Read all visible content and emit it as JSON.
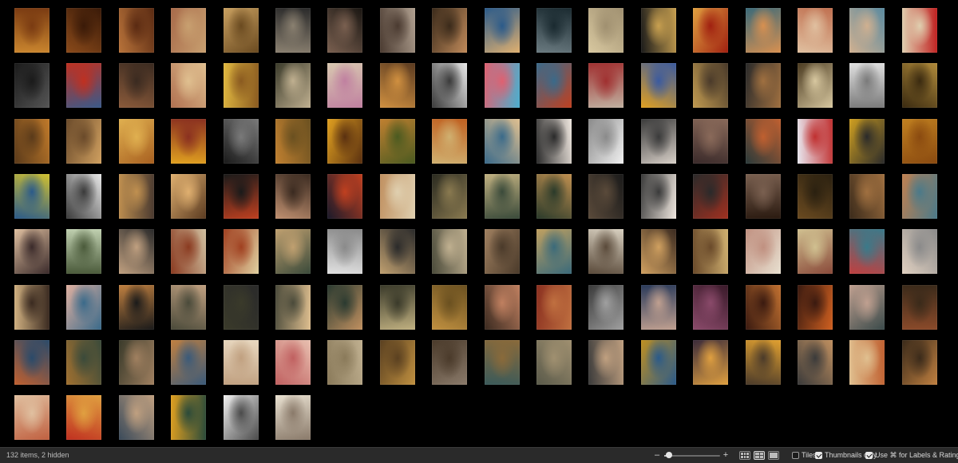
{
  "status": {
    "item_count": "132 items, 2 hidden",
    "zoom": {
      "minus": "–",
      "plus": "+",
      "level": 0.09
    },
    "options": [
      {
        "label": "Tiles",
        "checked": false
      },
      {
        "label": "Thumbnails only",
        "checked": true
      },
      {
        "label": "Use ⌘ for Labels & Ratings",
        "checked": true
      }
    ]
  },
  "thumbnails": {
    "visible_count": 132,
    "columns": 18,
    "palette": [
      [
        "#c9852e",
        "#7a3b12"
      ],
      [
        "#8a4a1a",
        "#3a1a08"
      ],
      [
        "#b8733a",
        "#5a2a12"
      ],
      [
        "#a86a4a",
        "#c8a070"
      ],
      [
        "#c9a060",
        "#6a4a20"
      ],
      [
        "#2a2a2a",
        "#8a8070"
      ],
      [
        "#1a1612",
        "#7a6050"
      ],
      [
        "#b0a090",
        "#4a3a30"
      ],
      [
        "#c08a5a",
        "#3a2a1a"
      ],
      [
        "#e0b070",
        "#2a5a8a"
      ],
      [
        "#6a7a80",
        "#1a2a30"
      ],
      [
        "#d8c8a0",
        "#a09070"
      ],
      [
        "#1a1a1a",
        "#c8a050"
      ],
      [
        "#e0a040",
        "#a02010"
      ],
      [
        "#3a6a7a",
        "#d89050"
      ],
      [
        "#c07050",
        "#e0c0a0"
      ],
      [
        "#5a8aa0",
        "#d0b090"
      ],
      [
        "#c02020",
        "#e0d0b0"
      ],
      [
        "#555555",
        "#1a1a1a"
      ],
      [
        "#3a5a8a",
        "#c03020"
      ],
      [
        "#8a5a3a",
        "#3a2a20"
      ],
      [
        "#b07050",
        "#e0c090"
      ],
      [
        "#e0b840",
        "#8a5a20"
      ],
      [
        "#3a3a2a",
        "#c0b090"
      ],
      [
        "#d8c8b0",
        "#c080a0"
      ],
      [
        "#5a3a20",
        "#d09040"
      ],
      [
        "#e8e8e8",
        "#3a3a3a"
      ],
      [
        "#4ab0d0",
        "#e06070"
      ],
      [
        "#c04020",
        "#3a6a8a"
      ],
      [
        "#c0b0a0",
        "#a03030"
      ],
      [
        "#e0a020",
        "#3a5aa0"
      ],
      [
        "#c09a50",
        "#4a3a2a"
      ],
      [
        "#2a2a2a",
        "#a07040"
      ],
      [
        "#4a3a20",
        "#d8c8a0"
      ],
      [
        "#e0e0e0",
        "#7a7a7a"
      ],
      [
        "#b08a3a",
        "#3a2a10"
      ],
      [
        "#c07a2a",
        "#5a3a1a"
      ],
      [
        "#d0a060",
        "#6a4a2a"
      ],
      [
        "#a86020",
        "#e0b050"
      ],
      [
        "#e0a020",
        "#8a3020"
      ],
      [
        "#1a1a1a",
        "#7a7a7a"
      ],
      [
        "#c08030",
        "#6a5020"
      ],
      [
        "#e0a020",
        "#5a3010"
      ],
      [
        "#c08030",
        "#4a5a20"
      ],
      [
        "#c06020",
        "#d0b070"
      ],
      [
        "#e0c090",
        "#3a6a8a"
      ],
      [
        "#f0e8e0",
        "#2a2a2a"
      ],
      [
        "#f0f0f0",
        "#8a8a8a"
      ],
      [
        "#d8d0c8",
        "#3a3a3a"
      ],
      [
        "#3a2a2a",
        "#8a6a5a"
      ],
      [
        "#2a3a3a",
        "#c06030"
      ],
      [
        "#e8e8f0",
        "#c03030"
      ],
      [
        "#d0a020",
        "#2a2a2a"
      ],
      [
        "#c08020",
        "#8a4a10"
      ],
      [
        "#d0c030",
        "#2a5a8a"
      ],
      [
        "#e8e8e8",
        "#3a3a3a"
      ],
      [
        "#4a3a30",
        "#c09050"
      ],
      [
        "#5a3a20",
        "#e0b070"
      ],
      [
        "#c04020",
        "#1a1a1a"
      ],
      [
        "#c09070",
        "#3a2a20"
      ],
      [
        "#1a1a2a",
        "#c04020"
      ],
      [
        "#c09060",
        "#e0d0b0"
      ],
      [
        "#2a2a20",
        "#8a7a50"
      ],
      [
        "#c0b080",
        "#3a4a3a"
      ],
      [
        "#c09050",
        "#2a3a2a"
      ],
      [
        "#1a1a1a",
        "#5a4a3a"
      ],
      [
        "#f0e8e0",
        "#3a3a3a"
      ],
      [
        "#a03020",
        "#2a2a2a"
      ],
      [
        "#2a1a10",
        "#7a6050"
      ],
      [
        "#6a4a20",
        "#2a2010"
      ],
      [
        "#3a2a1a",
        "#a07040"
      ],
      [
        "#c08050",
        "#4a7a8a"
      ],
      [
        "#e0c0a0",
        "#3a2a2a"
      ],
      [
        "#c0d0b0",
        "#4a5a3a"
      ],
      [
        "#2a2a2a",
        "#c0a080"
      ],
      [
        "#d0c0a0",
        "#8a3a20"
      ],
      [
        "#e0d0a0",
        "#a04020"
      ],
      [
        "#3a4a3a",
        "#c0a070"
      ],
      [
        "#e0e0e0",
        "#8a8a8a"
      ],
      [
        "#c0a070",
        "#2a2a2a"
      ],
      [
        "#4a4a3a",
        "#c0b090"
      ],
      [
        "#a08060",
        "#4a3a2a"
      ],
      [
        "#c0a060",
        "#3a6a7a"
      ],
      [
        "#d8d0c0",
        "#5a4a3a"
      ],
      [
        "#3a2a20",
        "#d0a060"
      ],
      [
        "#d0b070",
        "#6a4a2a"
      ],
      [
        "#e8e0d0",
        "#c09080"
      ],
      [
        "#8a4a3a",
        "#d0c090"
      ],
      [
        "#c04040",
        "#3a7a8a"
      ],
      [
        "#e0d0c0",
        "#8a8a8a"
      ],
      [
        "#d0b080",
        "#3a2a20"
      ],
      [
        "#e0b0a0",
        "#3a6a8a"
      ],
      [
        "#c08040",
        "#1a1a1a"
      ],
      [
        "#c0a080",
        "#4a4a3a"
      ],
      [
        "#2a2a2a",
        "#3a3a2a"
      ],
      [
        "#e0c090",
        "#4a4a3a"
      ],
      [
        "#c09060",
        "#2a3a30"
      ],
      [
        "#c0b080",
        "#3a3a2a"
      ],
      [
        "#c09040",
        "#6a5020"
      ],
      [
        "#3a2a20",
        "#c08060"
      ],
      [
        "#8a3020",
        "#c07040"
      ],
      [
        "#3a3a3a",
        "#a0a0a0"
      ],
      [
        "#2a3a5a",
        "#c0a090"
      ],
      [
        "#3a1a2a",
        "#8a4a6a"
      ],
      [
        "#c07030",
        "#3a1a10"
      ],
      [
        "#d06020",
        "#3a1a10"
      ],
      [
        "#3a4a4a",
        "#c0a090"
      ],
      [
        "#8a4a2a",
        "#3a2a1a"
      ],
      [
        "#c06030",
        "#2a4a6a"
      ],
      [
        "#a07030",
        "#3a4a3a"
      ],
      [
        "#3a3a2a",
        "#a08060"
      ],
      [
        "#c08040",
        "#3a5a7a"
      ],
      [
        "#e8d8c0",
        "#c0a080"
      ],
      [
        "#e8c0b0",
        "#c06060"
      ],
      [
        "#c0b090",
        "#8a7a5a"
      ],
      [
        "#c09040",
        "#5a4020"
      ],
      [
        "#8a7a6a",
        "#4a3a2a"
      ],
      [
        "#3a5a5a",
        "#8a6a3a"
      ],
      [
        "#5a5a4a",
        "#a09070"
      ],
      [
        "#3a3a3a",
        "#c0a080"
      ],
      [
        "#c09020",
        "#2a5a8a"
      ],
      [
        "#3a2a3a",
        "#e0a040"
      ],
      [
        "#e0a030",
        "#4a3a2a"
      ],
      [
        "#c09060",
        "#3a3a3a"
      ],
      [
        "#c06030",
        "#e0c090"
      ],
      [
        "#c08040",
        "#3a2a1a"
      ],
      [
        "#c06040",
        "#e0c0a0"
      ],
      [
        "#c03020",
        "#e0a040"
      ],
      [
        "#3a4a5a",
        "#c0a080"
      ],
      [
        "#e0a020",
        "#2a4a3a"
      ],
      [
        "#f0f0f0",
        "#4a4a4a"
      ],
      [
        "#e8e0d0",
        "#8a7a6a"
      ],
      [
        "#e0b0a0",
        "#8a6a5a"
      ],
      [
        "#c0c0c0",
        "#4a4a4a"
      ],
      [
        "#6a7a30",
        "#3a3a10"
      ],
      [
        "#e0d0b0",
        "#3a3a2a"
      ],
      [
        "#4a6a5a",
        "#c0a090"
      ],
      [
        "#e0c040",
        "#c03020"
      ],
      [
        "#4a4a30",
        "#1a1a10"
      ],
      [
        "#c0a090",
        "#3a2a2a"
      ]
    ]
  }
}
